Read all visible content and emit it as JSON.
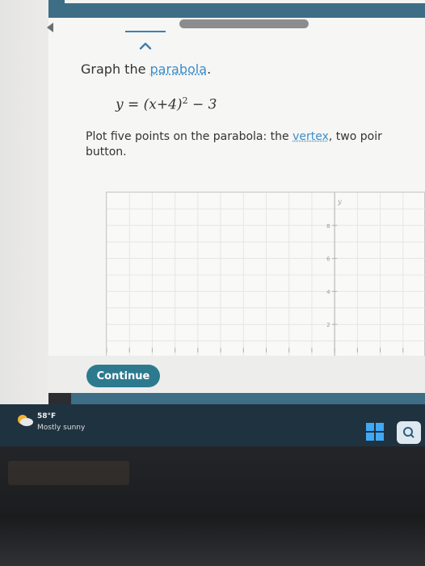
{
  "question": {
    "prompt_prefix": "Graph the ",
    "prompt_link": "parabola",
    "prompt_suffix": ".",
    "equation": {
      "lhs": "y = ",
      "base": "(x+4)",
      "exponent": "2",
      "tail": " − 3"
    },
    "instructions_prefix": "Plot five points on the parabola: the ",
    "instructions_link": "vertex",
    "instructions_suffix": ", two poir",
    "instructions_line2": "button."
  },
  "graph": {
    "y_axis_label": "y",
    "y_tick_labels": [
      "8",
      "6",
      "4",
      "2"
    ],
    "x_range": [
      -10,
      4
    ],
    "y_range": [
      0,
      10
    ]
  },
  "actions": {
    "continue_label": "Continue"
  },
  "taskbar": {
    "temperature": "58°F",
    "condition": "Mostly sunny"
  },
  "colors": {
    "accent": "#3d6e86",
    "link": "#3d8ec9",
    "continue_button": "#2d7a8f"
  },
  "icons": {
    "back": "back-arrow-icon",
    "collapse": "chevron-up-icon",
    "weather": "sun-cloud-icon",
    "start": "windows-icon",
    "search": "search-icon"
  }
}
